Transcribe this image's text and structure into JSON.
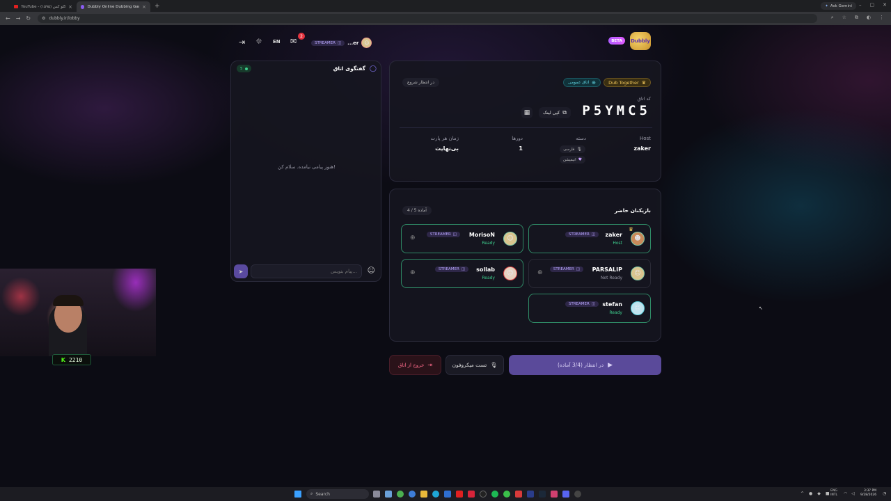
{
  "browser": {
    "tabs": [
      {
        "title": "YouTube - (۱۵۹۵) آغا گلو کس",
        "active": false
      },
      {
        "title": "Dubbly Online Dubbing Game",
        "active": true
      }
    ],
    "new_tab": "+",
    "ask_gemini": "Ask Gemini",
    "url": "dubbly.ir/lobby"
  },
  "header": {
    "logo_text": "Dubbly",
    "beta": "BETA",
    "user_name": "...er",
    "user_badge": "STREAMER",
    "notif_count": "2",
    "lang": "EN"
  },
  "room": {
    "dub_together": "Dub Together",
    "public_room": "اتاق عمومی",
    "waiting_status": "در انتظار شروع",
    "code_label": "کد اتاق",
    "code": "P5YMC5",
    "copy_link": "کپی لینک",
    "host_label": "Host",
    "host_value": "zaker",
    "category_label": "دسته",
    "category_1": "فارسی",
    "category_2": "انیمیشن",
    "rounds_label": "دورها",
    "rounds_value": "1",
    "time_label": "زمان هر پارت",
    "time_value": "بی‌نهایت"
  },
  "players_section": {
    "title": "بازیکنان حاضر",
    "ready_count": "4 / 5 آماده",
    "players": [
      {
        "name": "zaker",
        "badge": "STREAMER",
        "status": "Host",
        "ready": true
      },
      {
        "name": "MorisoN",
        "badge": "STREAMER",
        "status": "Ready",
        "ready": true
      },
      {
        "name": "PARSALIP",
        "badge": "STREAMER",
        "status": "Not Ready",
        "ready": false
      },
      {
        "name": "sollab",
        "badge": "STREAMER",
        "status": "Ready",
        "ready": true
      },
      {
        "name": "stefan",
        "badge": "STREAMER",
        "status": "Ready",
        "ready": true
      }
    ]
  },
  "chat": {
    "title": "گفتگوی اتاق",
    "count": "5",
    "empty": "هنوز پیامی نیامده. سلام کن!",
    "placeholder": "...پیام بنویس"
  },
  "actions": {
    "start_waiting": "در انتظار (3/4 آماده)",
    "mic_test": "تست میکروفون",
    "leave": "خروج از اتاق"
  },
  "webcam": {
    "counter": "2210"
  },
  "taskbar": {
    "search": "Search",
    "lang1": "ENG",
    "lang2": "INTL",
    "time": "3:37 PM",
    "date": "9/28/2026"
  },
  "colors": {
    "accent": "#7b5cf0",
    "ready_green": "#3ecf8e",
    "gold": "#e2b040",
    "danger": "#ff6b8b"
  }
}
